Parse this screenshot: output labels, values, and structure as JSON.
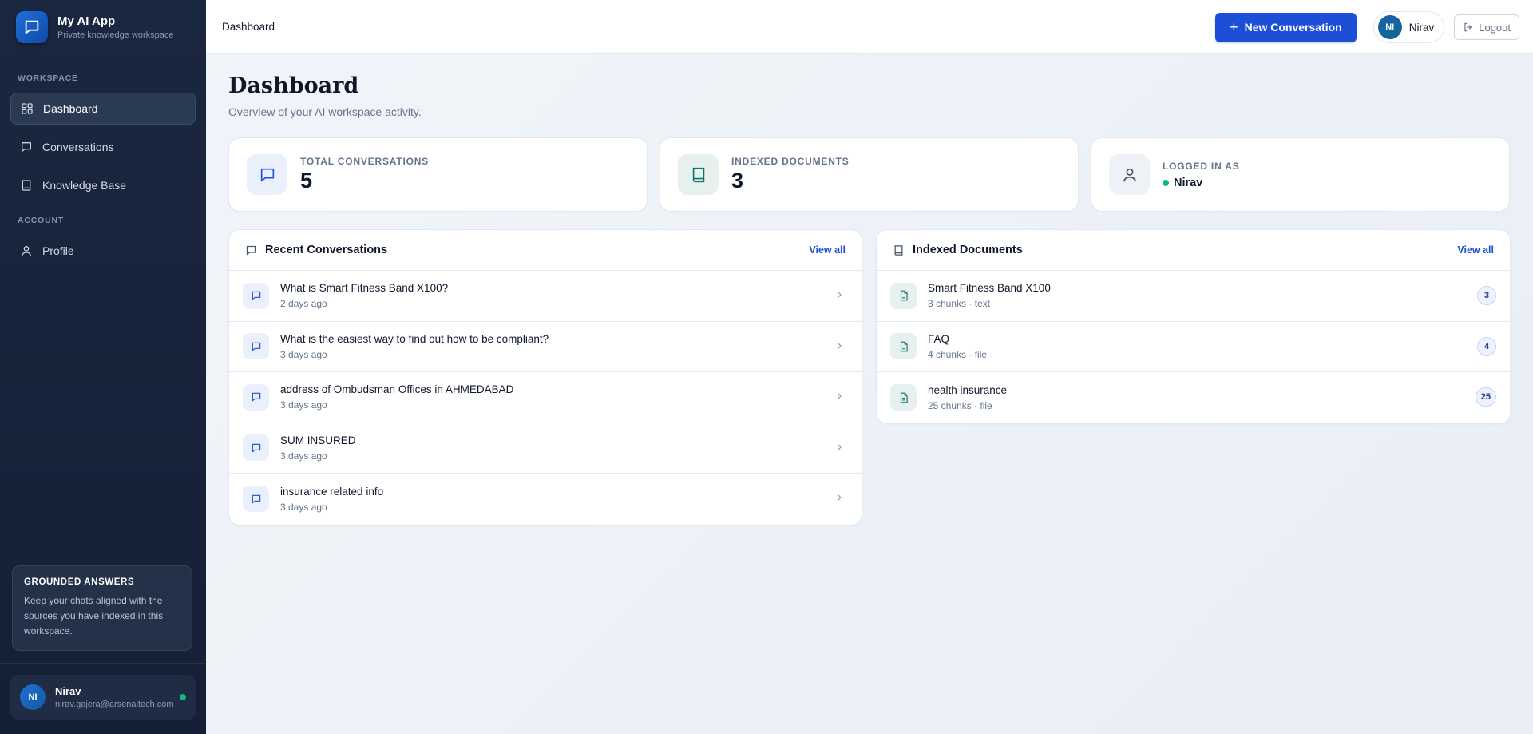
{
  "app": {
    "title": "My AI App",
    "subtitle": "Private knowledge workspace"
  },
  "sidebar": {
    "section_workspace": "WORKSPACE",
    "section_account": "ACCOUNT",
    "items": [
      {
        "label": "Dashboard",
        "icon": "grid-icon",
        "active": true
      },
      {
        "label": "Conversations",
        "icon": "chat-icon"
      },
      {
        "label": "Knowledge Base",
        "icon": "book-icon"
      },
      {
        "label": "Profile",
        "icon": "user-icon"
      }
    ],
    "promo": {
      "title": "GROUNDED ANSWERS",
      "text": "Keep your chats aligned with the sources you have indexed in this workspace."
    },
    "user": {
      "initials": "NI",
      "name": "Nirav",
      "email": "nirav.gajera@arsenaltech.com",
      "status_color": "#10b981"
    }
  },
  "topbar": {
    "breadcrumb": "Dashboard",
    "new_button": "New Conversation",
    "user_initials": "NI",
    "user_name": "Nirav",
    "logout": "Logout"
  },
  "page": {
    "title": "Dashboard",
    "subtitle": "Overview of your AI workspace activity."
  },
  "stats": {
    "conversations": {
      "label": "TOTAL CONVERSATIONS",
      "value": "5"
    },
    "documents": {
      "label": "INDEXED DOCUMENTS",
      "value": "3"
    },
    "logged": {
      "label": "LOGGED IN AS",
      "value": "Nirav"
    }
  },
  "recent": {
    "title": "Recent Conversations",
    "view_all": "View all",
    "items": [
      {
        "title": "What is Smart Fitness Band X100?",
        "time": "2 days ago"
      },
      {
        "title": "What is the easiest way to find out how to be compliant?",
        "time": "3 days ago"
      },
      {
        "title": "address of Ombudsman Offices in AHMEDABAD",
        "time": "3 days ago"
      },
      {
        "title": "SUM INSURED",
        "time": "3 days ago"
      },
      {
        "title": "insurance related info",
        "time": "3 days ago"
      }
    ]
  },
  "docs": {
    "title": "Indexed Documents",
    "view_all": "View all",
    "items": [
      {
        "title": "Smart Fitness Band X100",
        "meta": "3 chunks · text",
        "count": "3"
      },
      {
        "title": "FAQ",
        "meta": "4 chunks · file",
        "count": "4"
      },
      {
        "title": "health insurance",
        "meta": "25 chunks · file",
        "count": "25"
      }
    ]
  },
  "colors": {
    "accent": "#1d4ed8",
    "sidebar": "#1a2740",
    "online": "#10b981"
  }
}
